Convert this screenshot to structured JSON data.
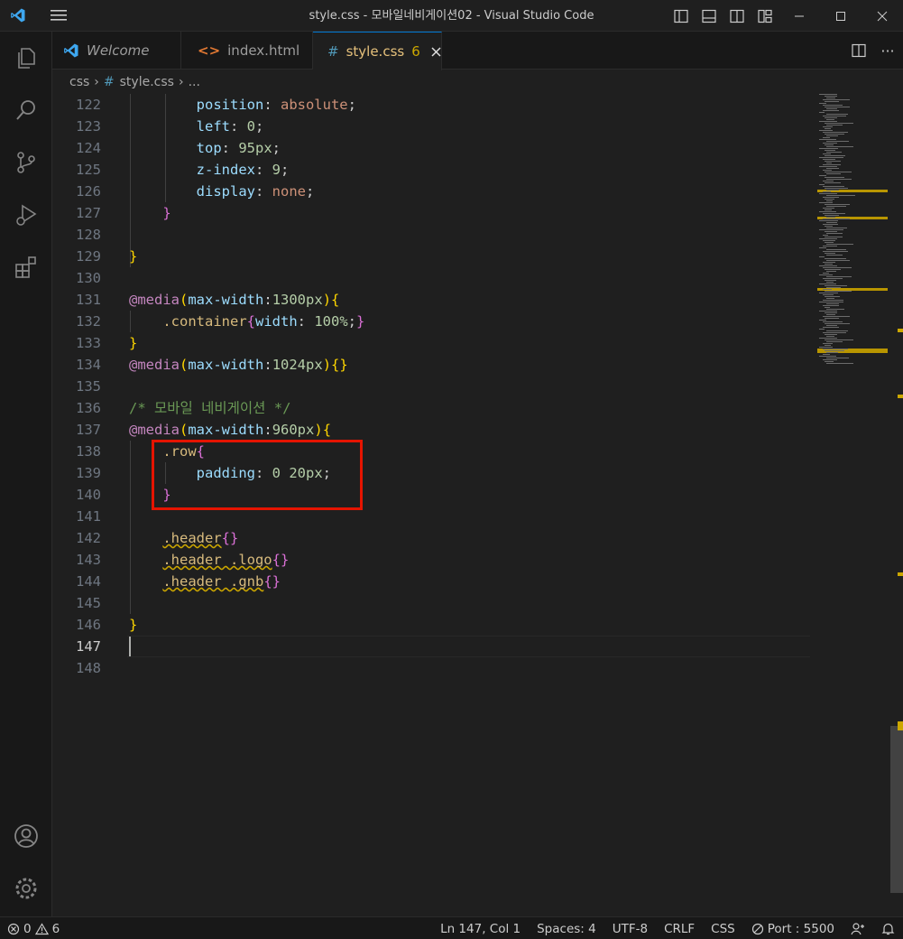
{
  "window": {
    "title": "style.css - 모바일네비게이션02 - Visual Studio Code"
  },
  "tabs": [
    {
      "label": "Welcome",
      "icon": "vscode-icon"
    },
    {
      "label": "index.html",
      "icon": "html-icon"
    },
    {
      "label": "style.css",
      "icon": "css-hash-icon",
      "badge": "6",
      "active": true
    }
  ],
  "breadcrumb": {
    "folder": "css",
    "file": "style.css",
    "more": "..."
  },
  "editor": {
    "line_numbers": [
      "122",
      "123",
      "124",
      "125",
      "126",
      "127",
      "128",
      "129",
      "130",
      "131",
      "132",
      "133",
      "134",
      "135",
      "136",
      "137",
      "138",
      "139",
      "140",
      "141",
      "142",
      "143",
      "144",
      "145",
      "146",
      "147",
      "148"
    ],
    "current_line": "147",
    "lines": [
      {
        "indent": "        ",
        "tokens": [
          {
            "t": "position",
            "c": "prop"
          },
          {
            "t": ": ",
            "c": "punc"
          },
          {
            "t": "absolute",
            "c": "val"
          },
          {
            "t": ";",
            "c": "punc"
          }
        ]
      },
      {
        "indent": "        ",
        "tokens": [
          {
            "t": "left",
            "c": "prop"
          },
          {
            "t": ": ",
            "c": "punc"
          },
          {
            "t": "0",
            "c": "num"
          },
          {
            "t": ";",
            "c": "punc"
          }
        ]
      },
      {
        "indent": "        ",
        "tokens": [
          {
            "t": "top",
            "c": "prop"
          },
          {
            "t": ": ",
            "c": "punc"
          },
          {
            "t": "95px",
            "c": "num"
          },
          {
            "t": ";",
            "c": "punc"
          }
        ]
      },
      {
        "indent": "        ",
        "tokens": [
          {
            "t": "z-index",
            "c": "prop"
          },
          {
            "t": ": ",
            "c": "punc"
          },
          {
            "t": "9",
            "c": "num"
          },
          {
            "t": ";",
            "c": "punc"
          }
        ]
      },
      {
        "indent": "        ",
        "tokens": [
          {
            "t": "display",
            "c": "prop"
          },
          {
            "t": ": ",
            "c": "punc"
          },
          {
            "t": "none",
            "c": "val"
          },
          {
            "t": ";",
            "c": "punc"
          }
        ]
      },
      {
        "indent": "    ",
        "tokens": [
          {
            "t": "}",
            "c": "br2"
          }
        ]
      },
      {
        "indent": "",
        "tokens": []
      },
      {
        "indent": "",
        "tokens": [
          {
            "t": "}",
            "c": "br1"
          }
        ]
      },
      {
        "indent": "",
        "tokens": []
      },
      {
        "indent": "",
        "tokens": [
          {
            "t": "@media",
            "c": "at"
          },
          {
            "t": "(",
            "c": "br1"
          },
          {
            "t": "max-width",
            "c": "prop"
          },
          {
            "t": ":",
            "c": "punc"
          },
          {
            "t": "1300px",
            "c": "num"
          },
          {
            "t": ")",
            "c": "br1"
          },
          {
            "t": "{",
            "c": "br1"
          }
        ]
      },
      {
        "indent": "    ",
        "tokens": [
          {
            "t": ".container",
            "c": "sel"
          },
          {
            "t": "{",
            "c": "br2"
          },
          {
            "t": "width",
            "c": "prop"
          },
          {
            "t": ": ",
            "c": "punc"
          },
          {
            "t": "100%",
            "c": "num"
          },
          {
            "t": ";",
            "c": "punc"
          },
          {
            "t": "}",
            "c": "br2"
          }
        ]
      },
      {
        "indent": "",
        "tokens": [
          {
            "t": "}",
            "c": "br1"
          }
        ]
      },
      {
        "indent": "",
        "tokens": [
          {
            "t": "@media",
            "c": "at"
          },
          {
            "t": "(",
            "c": "br1"
          },
          {
            "t": "max-width",
            "c": "prop"
          },
          {
            "t": ":",
            "c": "punc"
          },
          {
            "t": "1024px",
            "c": "num"
          },
          {
            "t": ")",
            "c": "br1"
          },
          {
            "t": "{}",
            "c": "br1"
          }
        ]
      },
      {
        "indent": "",
        "tokens": []
      },
      {
        "indent": "",
        "tokens": [
          {
            "t": "/* 모바일 네비게이션 */",
            "c": "cmt"
          }
        ]
      },
      {
        "indent": "",
        "tokens": [
          {
            "t": "@media",
            "c": "at"
          },
          {
            "t": "(",
            "c": "br1"
          },
          {
            "t": "max-width",
            "c": "prop"
          },
          {
            "t": ":",
            "c": "punc"
          },
          {
            "t": "960px",
            "c": "num"
          },
          {
            "t": ")",
            "c": "br1"
          },
          {
            "t": "{",
            "c": "br1"
          }
        ]
      },
      {
        "indent": "    ",
        "tokens": [
          {
            "t": ".row",
            "c": "sel"
          },
          {
            "t": "{",
            "c": "br2"
          }
        ]
      },
      {
        "indent": "        ",
        "tokens": [
          {
            "t": "padding",
            "c": "prop"
          },
          {
            "t": ": ",
            "c": "punc"
          },
          {
            "t": "0 20px",
            "c": "num"
          },
          {
            "t": ";",
            "c": "punc"
          }
        ]
      },
      {
        "indent": "    ",
        "tokens": [
          {
            "t": "}",
            "c": "br2"
          }
        ]
      },
      {
        "indent": "",
        "tokens": []
      },
      {
        "indent": "    ",
        "tokens": [
          {
            "t": ".header",
            "c": "sel wavy"
          },
          {
            "t": "{}",
            "c": "br2"
          }
        ]
      },
      {
        "indent": "    ",
        "tokens": [
          {
            "t": ".header .logo",
            "c": "sel wavy"
          },
          {
            "t": "{}",
            "c": "br2"
          }
        ]
      },
      {
        "indent": "    ",
        "tokens": [
          {
            "t": ".header .gnb",
            "c": "sel wavy"
          },
          {
            "t": "{}",
            "c": "br2"
          }
        ]
      },
      {
        "indent": "",
        "tokens": []
      },
      {
        "indent": "",
        "tokens": [
          {
            "t": "}",
            "c": "br1"
          }
        ]
      },
      {
        "indent": "",
        "tokens": []
      },
      {
        "indent": "",
        "tokens": []
      }
    ]
  },
  "statusbar": {
    "errors": "0",
    "warnings": "6",
    "position": "Ln 147, Col 1",
    "spaces": "Spaces: 4",
    "encoding": "UTF-8",
    "eol": "CRLF",
    "language": "CSS",
    "port": "Port : 5500"
  },
  "colors": {
    "accent": "#0078d4",
    "highlight_box": "#e51400",
    "warning": "#cca700"
  }
}
